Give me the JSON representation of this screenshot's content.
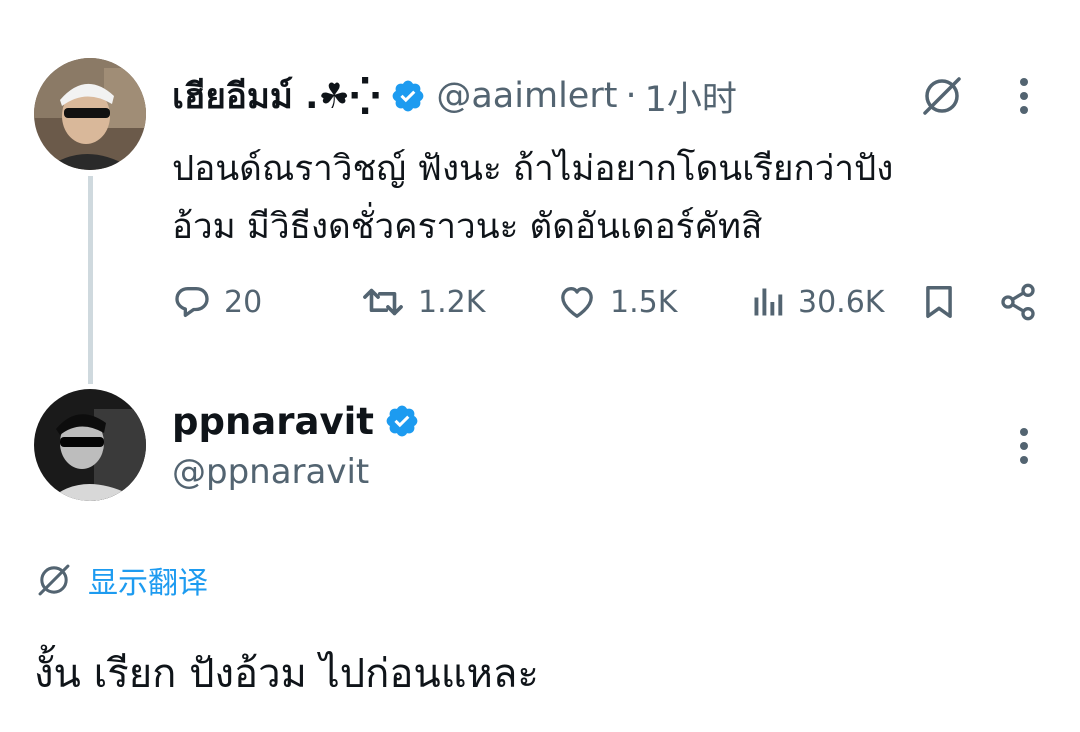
{
  "parent_tweet": {
    "display_name": "เฮียอีมม์ .☘︎⁛",
    "handle": "@aaimlert",
    "separator": "·",
    "time": "1小时",
    "text_lines": [
      "ปอนด์ณราวิชญ์ ฟังนะ ถ้าไม่อยากโดนเรียกว่าปัง",
      "อ้วม มีวิธีงดชั่วคราวนะ ตัดอันเดอร์คัทสิ"
    ],
    "stats": {
      "replies": "20",
      "retweets": "1.2K",
      "likes": "1.5K",
      "views": "30.6K"
    },
    "verified": true
  },
  "reply_tweet": {
    "display_name": "ppnaravit",
    "handle": "@ppnaravit",
    "verified": true,
    "show_translation_label": "显示翻译",
    "text": "งั้น เรียก ปังอ้วม ไปก่อนแหละ"
  },
  "icons": {
    "verified": "verified-badge-icon",
    "translate": "translate-icon",
    "more": "more-vertical-icon",
    "reply": "reply-icon",
    "retweet": "retweet-icon",
    "like": "heart-icon",
    "views": "views-icon",
    "bookmark": "bookmark-icon",
    "share": "share-icon"
  },
  "colors": {
    "accent": "#1d9bf0",
    "text": "#0f1419",
    "muted": "#536471",
    "thread_line": "#cfd9de"
  }
}
